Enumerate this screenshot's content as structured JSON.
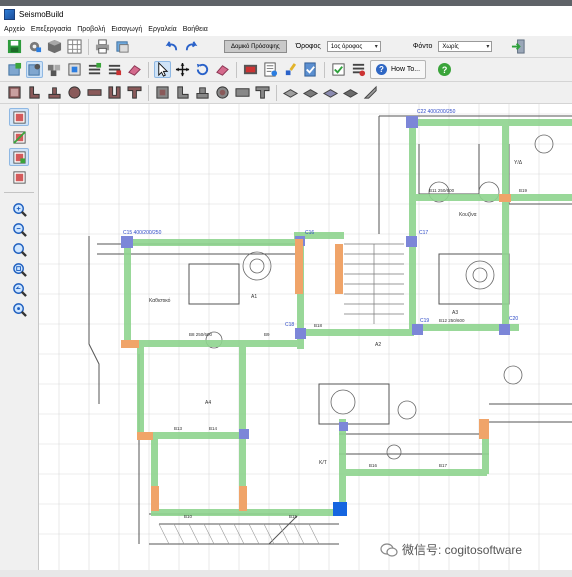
{
  "window": {
    "title": "SeismoBuild"
  },
  "menu": {
    "items": [
      "Αρχείο",
      "Επεξεργασία",
      "Προβολή",
      "Εισαγωγή",
      "Εργαλεία",
      "Βοήθεια"
    ]
  },
  "toolbar1": {
    "view_button_label": "Δομικό Πρόσοψης",
    "floor_label": "Όροφος",
    "floor_value": "1ος όροφος",
    "background_label": "Φόντο",
    "background_value": "Χωρίς"
  },
  "toolbar2": {
    "howto_label": "How To..."
  },
  "plan": {
    "column_labels": [
      "C15 400/200/250",
      "C22 400/200/250",
      "C16",
      "C19",
      "C18",
      "C17",
      "C20"
    ],
    "room_labels": [
      "Καθιστικό",
      "A1",
      "A2",
      "A3",
      "A4",
      "Κουζίνα",
      "Υ/Δ",
      "Κ/Τ"
    ],
    "beam_labels": [
      "B8 250/600",
      "B9",
      "B10",
      "B11 250/600",
      "B12 250/600",
      "B13",
      "B14",
      "B15",
      "B16",
      "B17",
      "B18",
      "B19"
    ],
    "colors": {
      "beam": "#8fd48f",
      "column": "#7c86d8",
      "column_edge": "#f0a469",
      "selected": "#1565e0"
    }
  },
  "watermark": {
    "text": "微信号: cogitosoftware"
  }
}
